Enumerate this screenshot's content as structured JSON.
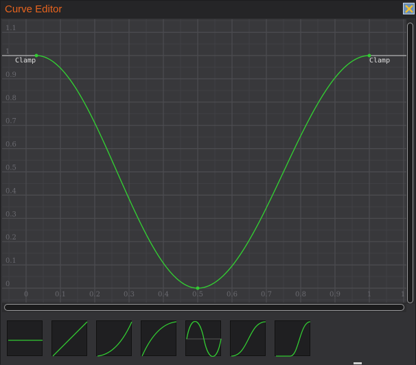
{
  "window": {
    "title": "Curve Editor",
    "accent_color": "#e8641e",
    "close_icon": "close-icon"
  },
  "graph": {
    "curve_color": "#33cc33",
    "y_labels": [
      "0",
      "0.1",
      "0.2",
      "0.3",
      "0.4",
      "0.5",
      "0.6",
      "0.7",
      "0.8",
      "0.9",
      "1",
      "1.1"
    ],
    "x_labels": [
      "0",
      "0.1",
      "0.2",
      "0.3",
      "0.4",
      "0.5",
      "0.6",
      "0.7",
      "0.8",
      "0.9",
      "1",
      "1"
    ],
    "keyframes": [
      {
        "x": 0.03,
        "y": 1.0,
        "label": "Clamp"
      },
      {
        "x": 0.5,
        "y": 0.0,
        "label": ""
      },
      {
        "x": 1.0,
        "y": 1.0,
        "label": "Clamp"
      }
    ]
  },
  "presets": [
    {
      "name": "constant-preset",
      "icon": "flat-line-icon"
    },
    {
      "name": "linear-preset",
      "icon": "diagonal-line-icon"
    },
    {
      "name": "ease-in-preset",
      "icon": "ease-in-curve-icon"
    },
    {
      "name": "ease-out-preset",
      "icon": "ease-out-curve-icon"
    },
    {
      "name": "sine-preset",
      "icon": "sine-wave-icon"
    },
    {
      "name": "ease-in-out-preset",
      "icon": "s-curve-icon"
    },
    {
      "name": "steep-ease-in-out-preset",
      "icon": "steep-s-curve-icon"
    }
  ]
}
